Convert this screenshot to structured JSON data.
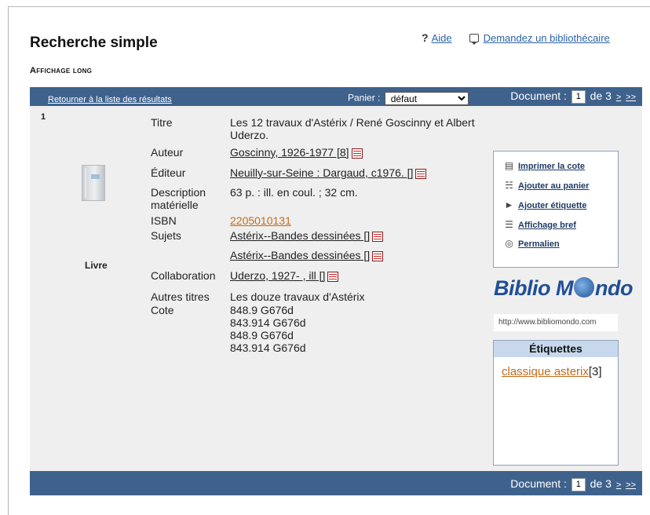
{
  "header": {
    "title": "Recherche simple",
    "subtitle": "Affichage long",
    "help_mark": "?",
    "help": "Aide",
    "ask_librarian": "Demandez un bibliothécaire"
  },
  "toolbar": {
    "back_to_results": "Retourner à la liste des résultats",
    "basket_label": "Panier :",
    "basket_selected": "défaut",
    "document_label": "Document :",
    "document_current": "1",
    "document_of": "de 3",
    "next": ">",
    "last": ">>"
  },
  "record": {
    "number": "1",
    "type": "Livre",
    "labels": {
      "title": "Titre",
      "author": "Auteur",
      "publisher": "Éditeur",
      "description": "Description matérielle",
      "isbn": "ISBN",
      "subjects": "Sujets",
      "collaboration": "Collaboration",
      "other_titles": "Autres titres",
      "call_number": "Cote"
    },
    "title": "Les 12 travaux d'Astérix / René Goscinny et Albert Uderzo.",
    "author": "Goscinny, 1926-1977 [8]",
    "publisher": "Neuilly-sur-Seine : Dargaud, c1976. []",
    "description": "63 p. : ill. en coul. ; 32 cm.",
    "isbn": "2205010131",
    "subjects": [
      "Astérix--Bandes dessinées []",
      "Astérix--Bandes dessinées []"
    ],
    "collaboration": "Uderzo, 1927- , ill []",
    "other_titles": "Les douze travaux d'Astérix",
    "call_numbers": [
      "848.9 G676d",
      "843.914 G676d",
      "848.9 G676d",
      "843.914 G676d"
    ]
  },
  "actions": {
    "print_call_number": "Imprimer la cote",
    "add_to_basket": "Ajouter au panier",
    "add_tag": "Ajouter étiquette",
    "brief_display": "Affichage bref",
    "permalink": "Permalien"
  },
  "branding": {
    "logo_left": "Biblio",
    "logo_m": "M",
    "logo_right": "ndo",
    "url": "http://www.bibliomondo.com"
  },
  "tags": {
    "heading": "Étiquettes",
    "items": [
      {
        "label": "classique asterix",
        "count": "[3]"
      }
    ]
  },
  "colors": {
    "bar": "#3e628c",
    "link": "#2c63a8",
    "tag_link": "#c46a1a",
    "panel_bg": "#efefef"
  }
}
